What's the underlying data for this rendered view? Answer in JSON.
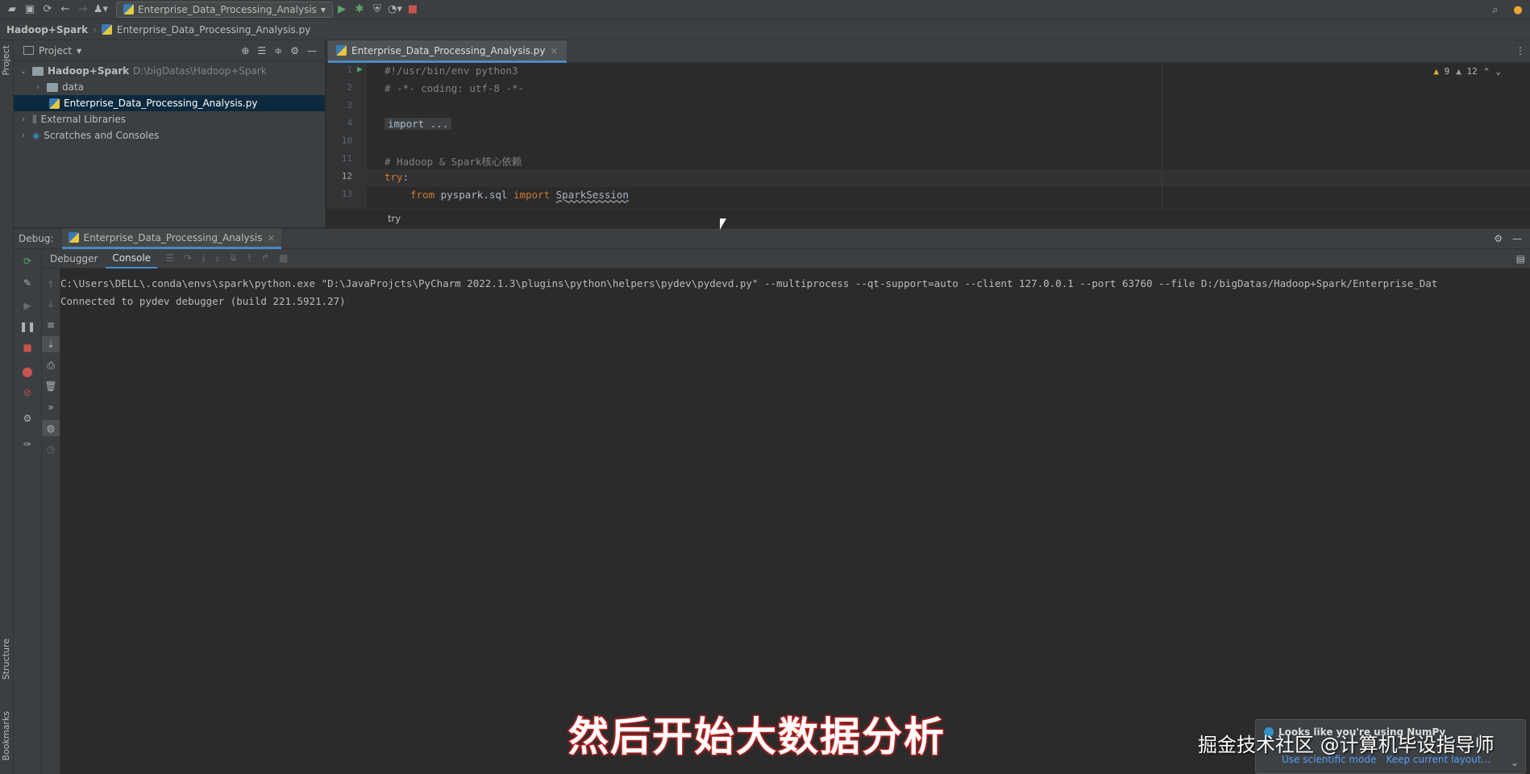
{
  "toolbar": {
    "run_config": "Enterprise_Data_Processing_Analysis"
  },
  "navbar": {
    "project": "Hadoop+Spark",
    "file": "Enterprise_Data_Processing_Analysis.py"
  },
  "left_stripe": {
    "project_label": "Project",
    "structure_label": "Structure",
    "bookmarks_label": "Bookmarks"
  },
  "project_panel": {
    "header": "Project",
    "tree": [
      {
        "label": "Hadoop+Spark",
        "path": "D:\\bigDatas\\Hadoop+Spark"
      },
      {
        "label": "data"
      },
      {
        "label": "Enterprise_Data_Processing_Analysis.py"
      },
      {
        "label": "External Libraries"
      },
      {
        "label": "Scratches and Consoles"
      }
    ]
  },
  "editor": {
    "tab": "Enterprise_Data_Processing_Analysis.py",
    "lines": [
      {
        "num": "1",
        "text": "#!/usr/bin/env python3"
      },
      {
        "num": "2",
        "text": "# -*- coding: utf-8 -*-"
      },
      {
        "num": "3",
        "text": ""
      },
      {
        "num": "4",
        "text": "import ..."
      },
      {
        "num": "10",
        "text": ""
      },
      {
        "num": "11",
        "text": "# Hadoop & Spark核心依赖"
      },
      {
        "num": "12",
        "kw": "try",
        "rest": ":"
      },
      {
        "num": "13",
        "kw1": "from",
        "mod": " pyspark.sql ",
        "kw2": "import",
        "cls": "SparkSession"
      }
    ],
    "breadcrumb": "try",
    "warnings_a": "9",
    "warnings_b": "12"
  },
  "debug": {
    "label": "Debug:",
    "session_tab": "Enterprise_Data_Processing_Analysis",
    "subtabs": [
      "Debugger",
      "Console"
    ],
    "console_lines": [
      "C:\\Users\\DELL\\.conda\\envs\\spark\\python.exe \"D:\\JavaProjcts\\PyCharm 2022.1.3\\plugins\\python\\helpers\\pydev\\pydevd.py\" --multiprocess --qt-support=auto --client 127.0.0.1 --port 63760 --file D:/bigDatas/Hadoop+Spark/Enterprise_Dat",
      "Connected to pydev debugger (build 221.5921.27)"
    ]
  },
  "overlay": {
    "subtitle": "然后开始大数据分析",
    "watermark": "掘金技术社区 @计算机毕设指导师"
  },
  "balloon": {
    "title": "Looks like you're using NumPy",
    "link1": "Use scientific mode",
    "link2": "Keep current layout..."
  }
}
